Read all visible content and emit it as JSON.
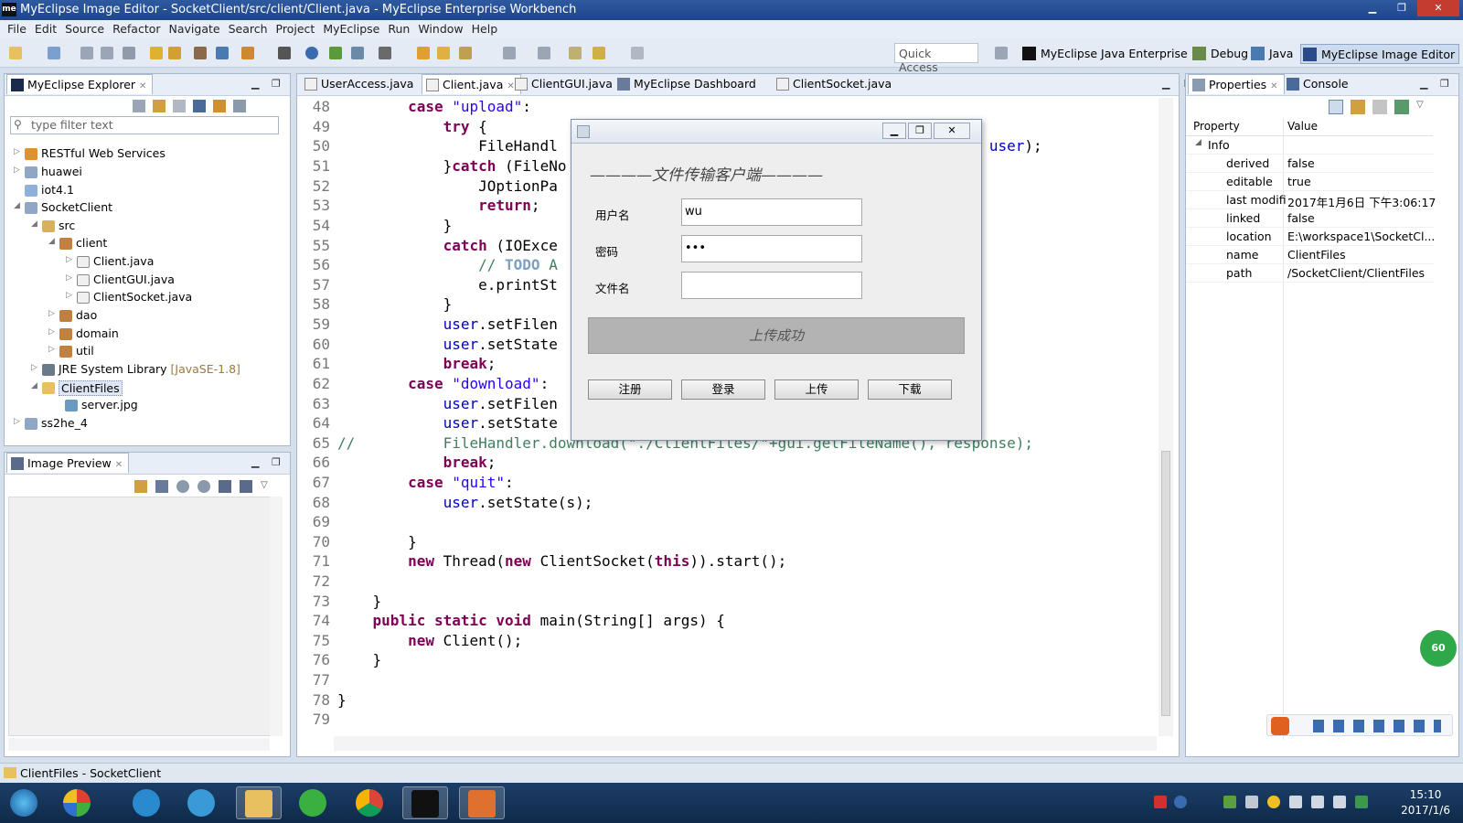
{
  "window": {
    "title": "MyEclipse Image Editor - SocketClient/src/client/Client.java - MyEclipse Enterprise Workbench",
    "logo": "me"
  },
  "menu": [
    "File",
    "Edit",
    "Source",
    "Refactor",
    "Navigate",
    "Search",
    "Project",
    "MyEclipse",
    "Run",
    "Window",
    "Help"
  ],
  "toolbar": {
    "quick_access": "Quick Access",
    "perspectives": [
      "MyEclipse Java Enterprise",
      "Debug",
      "Java",
      "MyEclipse Image Editor"
    ]
  },
  "explorer": {
    "tab": "MyEclipse Explorer",
    "filter_placeholder": "type filter text",
    "tree": [
      {
        "label": "RESTful Web Services",
        "icon": "rest-icon"
      },
      {
        "label": "huawei",
        "icon": "project-icon"
      },
      {
        "label": "iot4.1",
        "icon": "folder-icon"
      },
      {
        "label": "SocketClient",
        "icon": "project-icon"
      },
      {
        "label": "src",
        "icon": "source-folder-icon"
      },
      {
        "label": "client",
        "icon": "package-icon"
      },
      {
        "label": "Client.java",
        "icon": "java-file-icon"
      },
      {
        "label": "ClientGUI.java",
        "icon": "java-file-icon"
      },
      {
        "label": "ClientSocket.java",
        "icon": "java-file-icon"
      },
      {
        "label": "dao",
        "icon": "package-icon"
      },
      {
        "label": "domain",
        "icon": "package-icon"
      },
      {
        "label": "util",
        "icon": "package-icon"
      },
      {
        "label": "JRE System Library",
        "icon": "library-icon",
        "extra": "[JavaSE-1.8]"
      },
      {
        "label": "ClientFiles",
        "icon": "folder-icon"
      },
      {
        "label": "server.jpg",
        "icon": "image-file-icon"
      },
      {
        "label": "ss2he_4",
        "icon": "project-icon"
      }
    ]
  },
  "image_preview": {
    "tab": "Image Preview"
  },
  "editor": {
    "tabs": [
      "UserAccess.java",
      "Client.java",
      "ClientGUI.java",
      "MyEclipse Dashboard",
      "ClientSocket.java"
    ],
    "active_tab": "Client.java",
    "line_numbers": [
      "48",
      "49",
      "50",
      "51",
      "52",
      "53",
      "54",
      "55",
      "56",
      "57",
      "58",
      "59",
      "60",
      "61",
      "62",
      "63",
      "64",
      "65",
      "66",
      "67",
      "68",
      "69",
      "70",
      "71",
      "72",
      "73",
      "74",
      "75",
      "76",
      "77",
      "78",
      "79"
    ]
  },
  "dialog": {
    "heading": "————文件传输客户端————",
    "username_label": "用户名",
    "username_value": "wu",
    "password_label": "密码",
    "password_value": "•••",
    "filename_label": "文件名",
    "filename_value": "",
    "status": "上传成功",
    "buttons": [
      "注册",
      "登录",
      "上传",
      "下载"
    ]
  },
  "properties": {
    "tabs": [
      "Properties",
      "Console"
    ],
    "headers": [
      "Property",
      "Value"
    ],
    "group": "Info",
    "rows": [
      {
        "key": "derived",
        "value": "false"
      },
      {
        "key": "editable",
        "value": "true"
      },
      {
        "key": "last modifi",
        "value": "2017年1月6日 下午3:06:17"
      },
      {
        "key": "linked",
        "value": "false"
      },
      {
        "key": "location",
        "value": "E:\\workspace1\\SocketCl..."
      },
      {
        "key": "name",
        "value": "ClientFiles"
      },
      {
        "key": "path",
        "value": "/SocketClient/ClientFiles"
      }
    ]
  },
  "statusbar": {
    "text": "ClientFiles - SocketClient"
  },
  "taskbar": {
    "time": "15:10",
    "date": "2017/1/6",
    "badge": "60"
  },
  "colors": {
    "keyword": "#7f0055",
    "string": "#2a00ff",
    "field": "#0000c0",
    "comment": "#3f7f5f",
    "titlebar": "#2f5aa0"
  }
}
